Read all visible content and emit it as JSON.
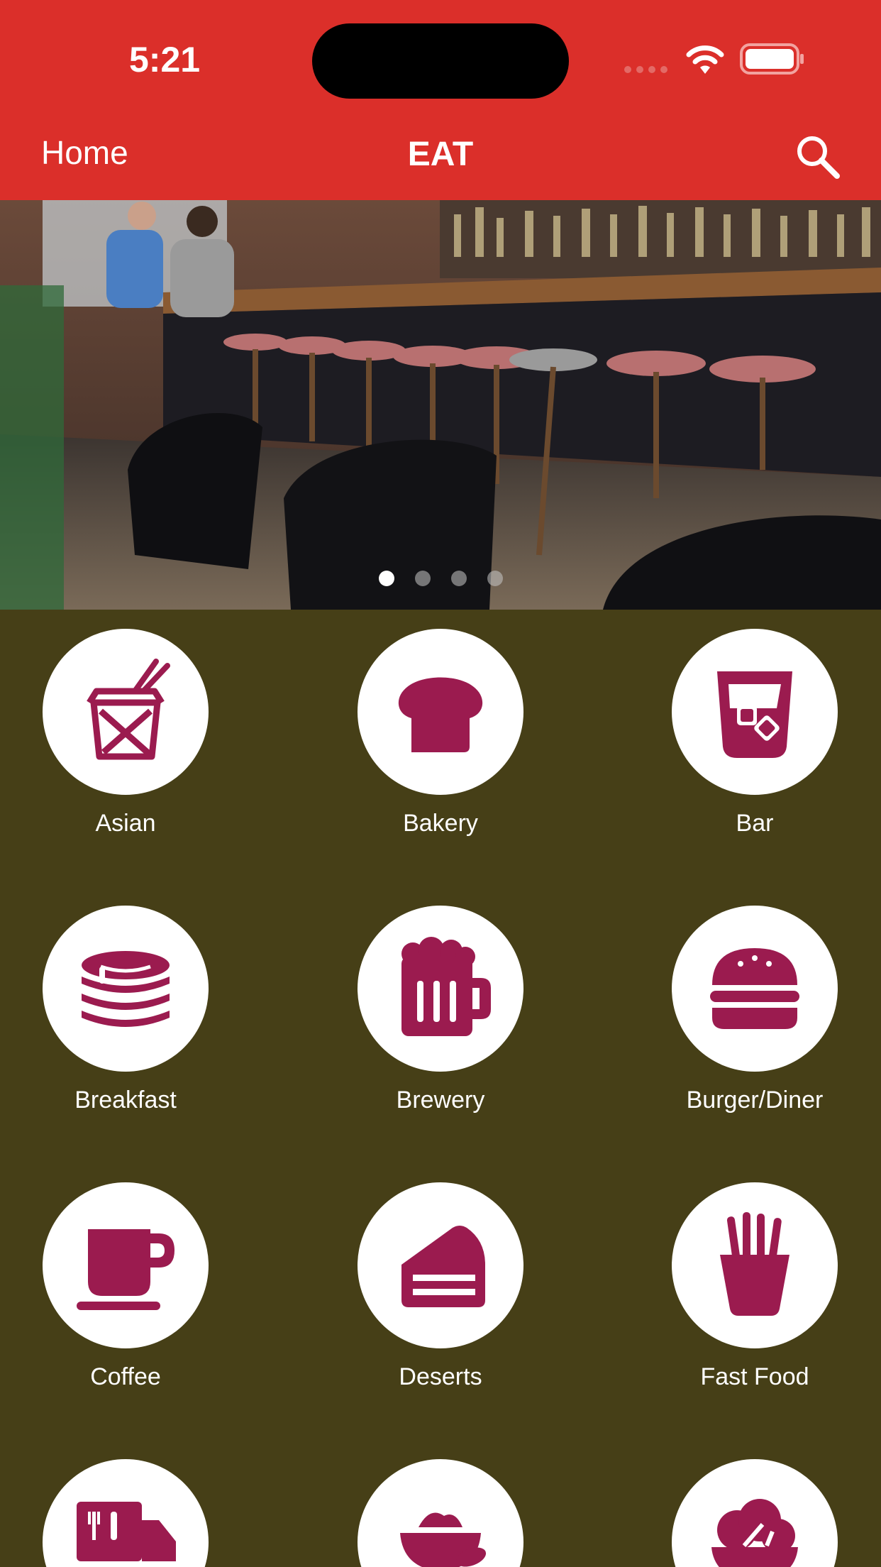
{
  "status_bar": {
    "time": "5:21"
  },
  "nav": {
    "left_label": "Home",
    "title": "EAT",
    "search_icon": "search-icon"
  },
  "hero": {
    "image": "bar interior with stools photo",
    "pager": {
      "count": 4,
      "active_index": 0
    }
  },
  "colors": {
    "topbar": "#db2f2a",
    "background": "#463f17",
    "icon": "#9b1b4f",
    "circle": "#ffffff"
  },
  "categories": [
    {
      "label": "Asian",
      "icon": "takeout-box-icon"
    },
    {
      "label": "Bakery",
      "icon": "bread-icon"
    },
    {
      "label": "Bar",
      "icon": "glass-ice-icon"
    },
    {
      "label": "Breakfast",
      "icon": "pancakes-icon"
    },
    {
      "label": "Brewery",
      "icon": "beer-mug-icon"
    },
    {
      "label": "Burger/Diner",
      "icon": "burger-icon"
    },
    {
      "label": "Coffee",
      "icon": "coffee-cup-icon"
    },
    {
      "label": "Deserts",
      "icon": "cake-slice-icon"
    },
    {
      "label": "Fast Food",
      "icon": "fries-icon"
    },
    {
      "label": "",
      "icon": "food-truck-icon"
    },
    {
      "label": "",
      "icon": "rice-bowl-icon"
    },
    {
      "label": "",
      "icon": "salad-icon"
    }
  ]
}
